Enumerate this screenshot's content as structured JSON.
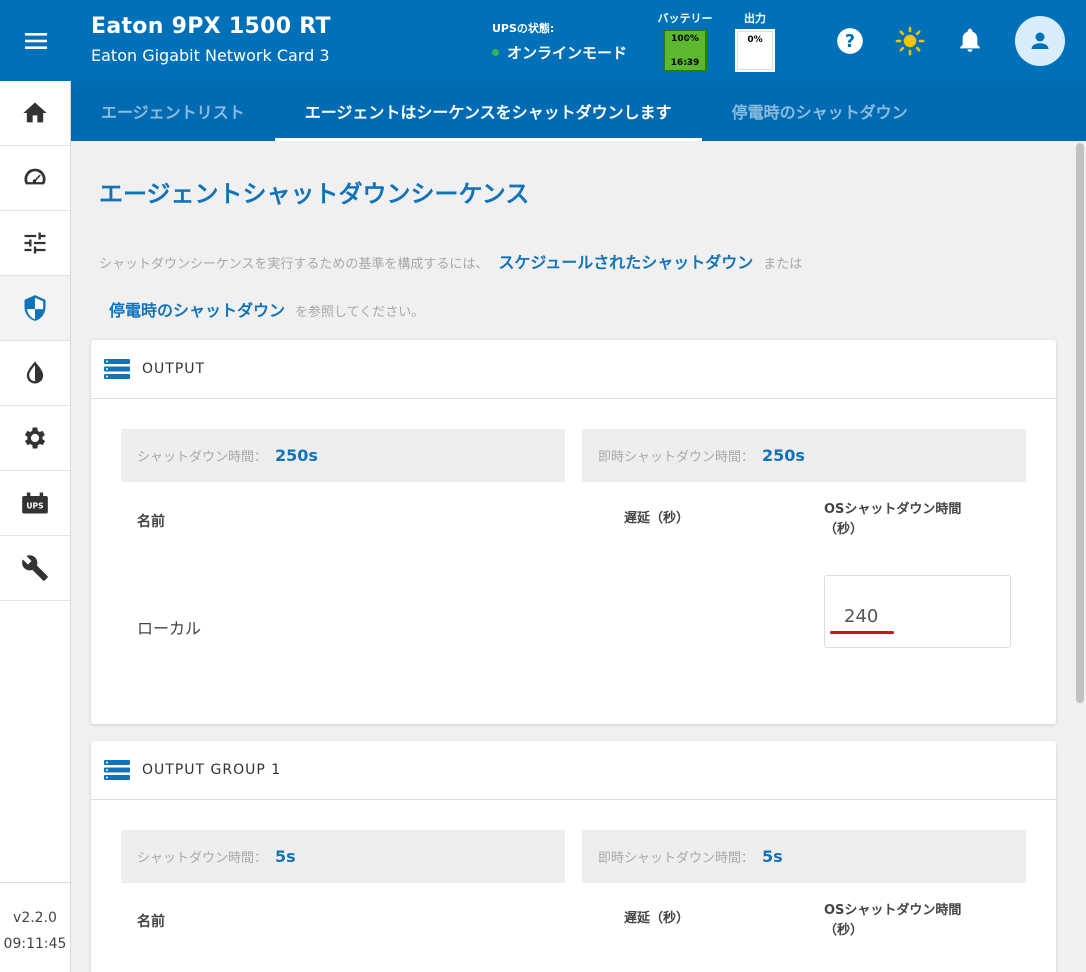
{
  "header": {
    "title": "Eaton 9PX 1500 RT",
    "subtitle": "Eaton Gigabit Network Card 3",
    "ups_state_label": "UPSの状態:",
    "ups_state_value": "オンラインモード",
    "battery_label": "バッテリー",
    "battery_percent": "100%",
    "battery_time": "16:39",
    "output_label": "出力",
    "output_percent": "0%",
    "status_color": "#37b24d",
    "accent_color": "#0071b9"
  },
  "sidebar": {
    "items": [
      {
        "icon": "home-icon"
      },
      {
        "icon": "gauge-icon"
      },
      {
        "icon": "sliders-icon"
      },
      {
        "icon": "shield-icon",
        "active": true
      },
      {
        "icon": "drop-icon"
      },
      {
        "icon": "gear-icon"
      },
      {
        "icon": "ups-icon",
        "text": "UPS"
      },
      {
        "icon": "wrench-icon"
      }
    ],
    "version": "v2.2.0",
    "time": "09:11:45"
  },
  "tabs": [
    {
      "label": "エージェントリスト",
      "active": false
    },
    {
      "label": "エージェントはシーケンスをシャットダウンします",
      "active": true
    },
    {
      "label": "停電時のシャットダウン",
      "active": false
    }
  ],
  "main": {
    "title": "エージェントシャットダウンシーケンス",
    "intro_prefix": "シャットダウンシーケンスを実行するための基準を構成するには、",
    "intro_link1": "スケジュールされたシャットダウン",
    "intro_or": "または",
    "intro_link2": "停電時のシャットダウン",
    "intro_suffix": "を参照してください。"
  },
  "cards": [
    {
      "title": "OUTPUT",
      "shutdown_label": "シャットダウン時間：",
      "shutdown_value": "250s",
      "immediate_label": "即時シャットダウン時間：",
      "immediate_value": "250s",
      "col_name": "名前",
      "col_delay": "遅延（秒）",
      "col_os_line1": "OSシャットダウン時間",
      "col_os_line2": "（秒）",
      "row_name": "ローカル",
      "row_os_value": "240"
    },
    {
      "title": "OUTPUT GROUP 1",
      "shutdown_label": "シャットダウン時間：",
      "shutdown_value": "5s",
      "immediate_label": "即時シャットダウン時間：",
      "immediate_value": "5s",
      "col_name": "名前",
      "col_delay": "遅延（秒）",
      "col_os_line1": "OSシャットダウン時間",
      "col_os_line2": "（秒）"
    }
  ]
}
